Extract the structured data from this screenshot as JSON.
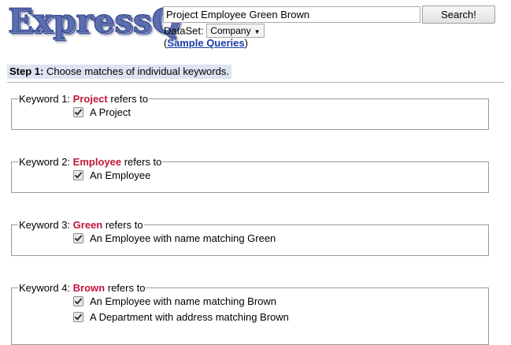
{
  "logo": {
    "text": "ExpressQ"
  },
  "search": {
    "value": "Project Employee Green Brown",
    "button_label": "Search!"
  },
  "dataset": {
    "label": "DataSet:",
    "selected": "Company"
  },
  "sample": {
    "open": "(",
    "link": "Sample Queries",
    "close": ")"
  },
  "step1": {
    "label": "Step 1:",
    "text": " Choose matches of individual keywords."
  },
  "keywords": [
    {
      "prefix": "Keyword 1:",
      "word": "Project",
      "suffix": "refers to",
      "options": [
        "A Project"
      ]
    },
    {
      "prefix": "Keyword 2:",
      "word": "Employee",
      "suffix": "refers to",
      "options": [
        "An Employee"
      ]
    },
    {
      "prefix": "Keyword 3:",
      "word": "Green",
      "suffix": "refers to",
      "options": [
        "An Employee with name matching Green"
      ]
    },
    {
      "prefix": "Keyword 4:",
      "word": "Brown",
      "suffix": "refers to",
      "options": [
        "An Employee with name matching Brown",
        "A Department with address matching Brown"
      ]
    }
  ]
}
